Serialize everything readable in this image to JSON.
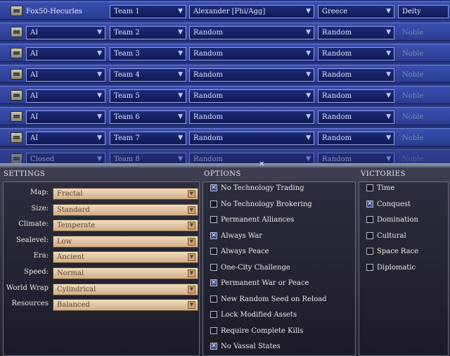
{
  "players": [
    {
      "name": "Fox50-Hecurles",
      "team": "Team 1",
      "leader": "Alexander [Phi/Agg]",
      "civ": "Greece",
      "difficulty": "Deity",
      "human": true
    },
    {
      "type": "AI",
      "team": "Team 2",
      "leader": "Random",
      "civ": "Random",
      "difficulty": "Noble"
    },
    {
      "type": "AI",
      "team": "Team 3",
      "leader": "Random",
      "civ": "Random",
      "difficulty": "Noble"
    },
    {
      "type": "AI",
      "team": "Team 4",
      "leader": "Random",
      "civ": "Random",
      "difficulty": "Noble"
    },
    {
      "type": "AI",
      "team": "Team 5",
      "leader": "Random",
      "civ": "Random",
      "difficulty": "Noble"
    },
    {
      "type": "AI",
      "team": "Team 6",
      "leader": "Random",
      "civ": "Random",
      "difficulty": "Noble"
    },
    {
      "type": "AI",
      "team": "Team 7",
      "leader": "Random",
      "civ": "Random",
      "difficulty": "Noble"
    }
  ],
  "partial_row": {
    "type": "Closed",
    "team": "Team 8",
    "leader": "Random",
    "civ": "Random",
    "difficulty": "Noble"
  },
  "divider_glyph": "✕",
  "settings_header": "SETTINGS",
  "options_header": "OPTIONS",
  "victories_header": "VICTORIES",
  "settings": [
    {
      "label": "Map:",
      "value": "Fractal"
    },
    {
      "label": "Size:",
      "value": "Standard"
    },
    {
      "label": "Climate:",
      "value": "Temperate"
    },
    {
      "label": "Sealevel:",
      "value": "Low"
    },
    {
      "label": "Era:",
      "value": "Ancient"
    },
    {
      "label": "Speed:",
      "value": "Normal"
    },
    {
      "label": "World Wrap",
      "value": "Cylindrical"
    },
    {
      "label": "Resources",
      "value": "Balanced"
    }
  ],
  "options": [
    {
      "label": "No Technology Trading",
      "checked": true
    },
    {
      "label": "No Technology Brokering",
      "checked": false
    },
    {
      "label": "Permanent Alliances",
      "checked": false
    },
    {
      "label": "Always War",
      "checked": true
    },
    {
      "label": "Always Peace",
      "checked": false
    },
    {
      "label": "One-City Challenge",
      "checked": false
    },
    {
      "label": "Permanent War or Peace",
      "checked": true
    },
    {
      "label": "New Random Seed on Reload",
      "checked": false
    },
    {
      "label": "Lock Modified Assets",
      "checked": false
    },
    {
      "label": "Require Complete Kills",
      "checked": false
    },
    {
      "label": "No Vassal States",
      "checked": true
    }
  ],
  "victories": [
    {
      "label": "Time",
      "checked": false
    },
    {
      "label": "Conquest",
      "checked": true
    },
    {
      "label": "Domination",
      "checked": false
    },
    {
      "label": "Cultural",
      "checked": false
    },
    {
      "label": "Space Race",
      "checked": false
    },
    {
      "label": "Diplomatic",
      "checked": false
    }
  ]
}
